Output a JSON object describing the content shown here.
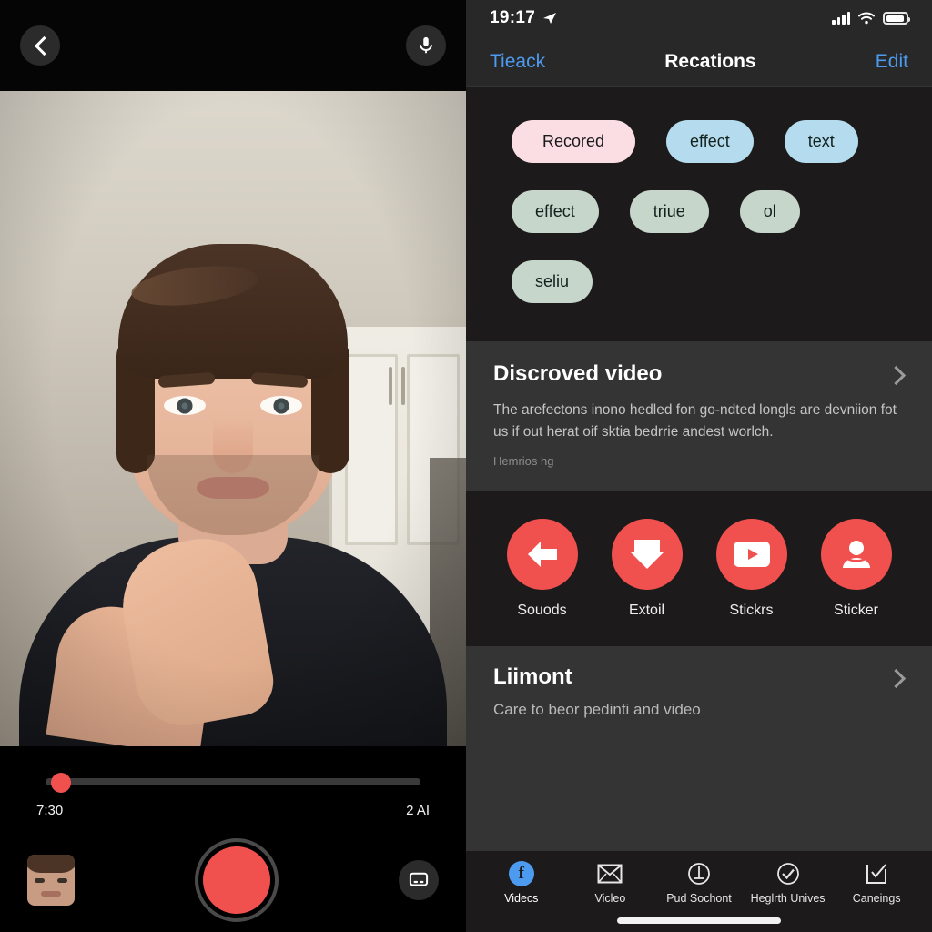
{
  "camera": {
    "back_button": "back-chevron",
    "mic_button": "microphone",
    "timeline": {
      "current_time": "7:30",
      "total_time": "2 AI",
      "progress_percent": 2
    },
    "thumbnail_label": "preview-thumbnail",
    "record_button": "record",
    "caption_button": "captions"
  },
  "phone": {
    "statusbar": {
      "time": "19:17",
      "location_icon": "location-arrow-icon",
      "signal_icon": "cellular-signal-icon",
      "wifi_icon": "wifi-icon",
      "battery_icon": "battery-icon"
    },
    "navbar": {
      "back_label": "Tieack",
      "title": "Recations",
      "edit_label": "Edit"
    },
    "chips": [
      [
        {
          "label": "Recored",
          "style": "pink"
        },
        {
          "label": "effect",
          "style": "blue"
        },
        {
          "label": "text",
          "style": "blue"
        }
      ],
      [
        {
          "label": "effect",
          "style": "sage"
        },
        {
          "label": "triue",
          "style": "sage"
        },
        {
          "label": "ol",
          "style": "sage"
        }
      ],
      [
        {
          "label": "seliu",
          "style": "sage"
        }
      ]
    ],
    "info_card": {
      "title": "Discroved video",
      "body": "The arefectons inono hedled fon go-ndted longls are devniion fot us if out herat oif sktia bedrrie andest worlch.",
      "meta": "Hemrios hg",
      "chevron": "chevron-right-icon"
    },
    "actions": [
      {
        "label": "Souods",
        "icon": "arrow-left-icon"
      },
      {
        "label": "Extoil",
        "icon": "arrow-down-icon"
      },
      {
        "label": "Stickrs",
        "icon": "video-play-icon"
      },
      {
        "label": "Sticker",
        "icon": "person-icon"
      }
    ],
    "limit_card": {
      "title": "Liimont",
      "subtitle": "Care to beor pedinti and video",
      "chevron": "chevron-right-icon"
    },
    "tabs": [
      {
        "label": "Videcs",
        "icon": "facebook-icon",
        "active": true
      },
      {
        "label": "Vicleo",
        "icon": "envelope-icon",
        "active": false
      },
      {
        "label": "Pud Sochont",
        "icon": "circle-line-icon",
        "active": false
      },
      {
        "label": "Heglrth Unives",
        "icon": "check-circle-icon",
        "active": false
      },
      {
        "label": "Caneings",
        "icon": "checked-square-icon",
        "active": false
      }
    ]
  },
  "colors": {
    "accent_red": "#f0514f",
    "accent_blue": "#4d9bf0",
    "chip_pink": "#fadee4",
    "chip_blue": "#b4dcee",
    "chip_sage": "#c6d6cb",
    "card_bg": "#343434",
    "panel_bg": "#1c1a1a"
  }
}
